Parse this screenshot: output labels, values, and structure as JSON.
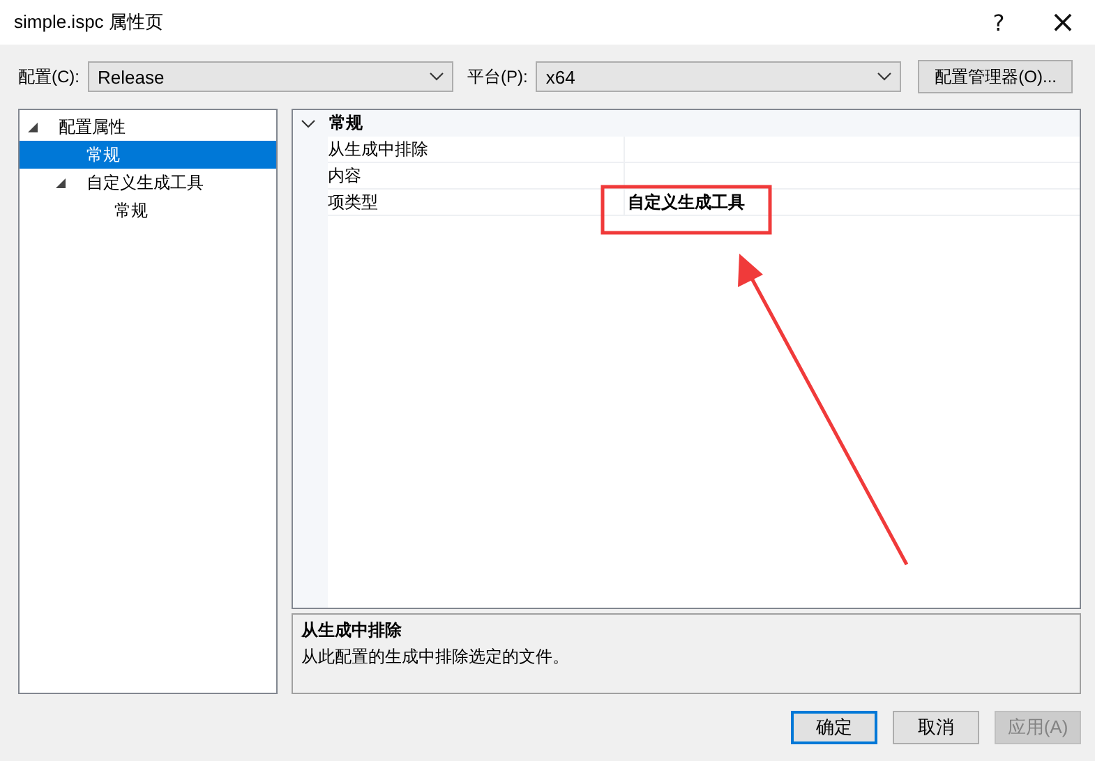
{
  "window": {
    "title": "simple.ispc 属性页",
    "help": "?",
    "close": "×"
  },
  "toolbar": {
    "configuration": {
      "label": "配置(C):",
      "value": "Release"
    },
    "platform": {
      "label": "平台(P):",
      "value": "x64"
    },
    "manager_button": "配置管理器(O)..."
  },
  "tree": [
    {
      "label": "配置属性",
      "expanded": true,
      "selected": false,
      "children": [
        {
          "label": "常规",
          "selected": true
        },
        {
          "label": "自定义生成工具",
          "expanded": true,
          "selected": false,
          "children": [
            {
              "label": "常规",
              "selected": false
            }
          ]
        }
      ]
    }
  ],
  "grid": {
    "categories": [
      {
        "label": "常规",
        "expanded": true,
        "properties": [
          {
            "name": "从生成中排除"
          },
          {
            "name": "内容"
          },
          {
            "name": "项类型",
            "value": "自定义生成工具",
            "modified": true
          }
        ]
      }
    ]
  },
  "description": {
    "title": "从生成中排除",
    "text": "从此配置的生成中排除选定的文件。"
  },
  "buttons": [
    {
      "label": "确定",
      "default": true,
      "disabled": false
    },
    {
      "label": "取消",
      "default": false,
      "disabled": false
    },
    {
      "label": "应用(A)",
      "default": false,
      "disabled": true
    }
  ]
}
